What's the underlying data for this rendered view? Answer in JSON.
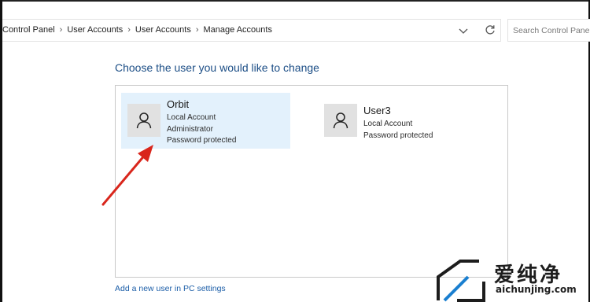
{
  "breadcrumb": {
    "items": [
      "Control Panel",
      "User Accounts",
      "User Accounts",
      "Manage Accounts"
    ]
  },
  "search": {
    "placeholder": "Search Control Panel"
  },
  "heading": "Choose the user you would like to change",
  "accounts": [
    {
      "name": "Orbit",
      "details": [
        "Local Account",
        "Administrator",
        "Password protected"
      ],
      "selected": true
    },
    {
      "name": "User3",
      "details": [
        "Local Account",
        "Password protected"
      ],
      "selected": false
    }
  ],
  "add_user_link": "Add a new user in PC settings",
  "watermark": {
    "cn_text": "爱纯净",
    "url": "aichunjing.com"
  },
  "colors": {
    "accent": "#1c4e86",
    "selection": "#e3f1fc",
    "arrow": "#d9261c"
  }
}
